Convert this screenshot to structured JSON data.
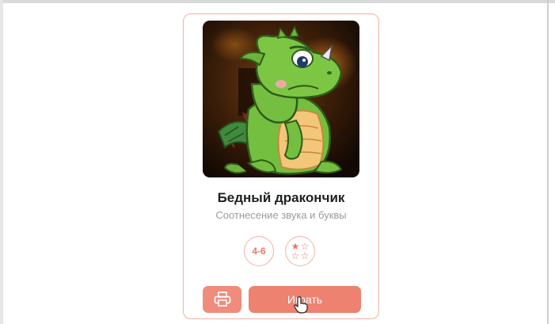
{
  "card": {
    "title": "Бедный дракончик",
    "subtitle": "Соотнесение звука и буквы",
    "age_badge": "4-6",
    "difficulty": {
      "rating": 1,
      "max": 3,
      "filled_star": "★",
      "empty_star": "☆"
    },
    "print_icon": "printer-icon",
    "play_label": "Играть",
    "illustration": "sad-green-dragon"
  },
  "colors": {
    "accent": "#ee8271",
    "border": "#f2b2a7",
    "title": "#1f1f1f",
    "subtitle": "#9b9b9b"
  }
}
